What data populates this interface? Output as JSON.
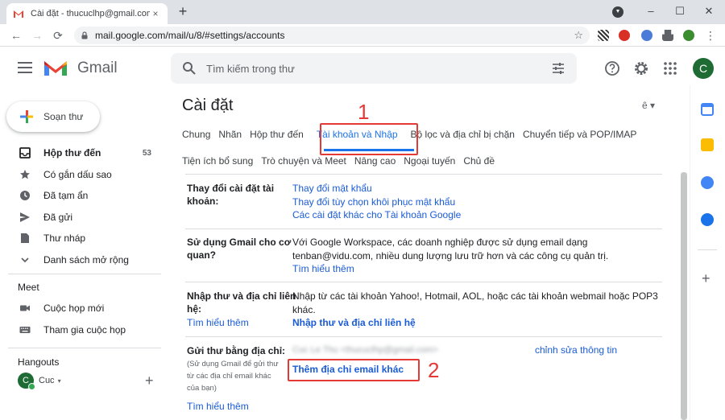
{
  "browser": {
    "tab_title": "Cài đặt - thucuclhp@gmail.com",
    "tab_close": "×",
    "new_tab": "+",
    "url": "mail.google.com/mail/u/8/#settings/accounts",
    "win_minimize": "–",
    "win_restore": "☐",
    "win_close": "✕",
    "back": "←",
    "forward": "→",
    "reload": "⟳",
    "menu": "⋮",
    "bookmark_star": "☆"
  },
  "gmail": {
    "logo_text": "Gmail",
    "search_placeholder": "Tìm kiếm trong thư",
    "avatar_letter": "C"
  },
  "sidebar": {
    "compose_label": "Soạn thư",
    "items": [
      {
        "label": "Hộp thư đến",
        "count": "53",
        "icon": "inbox-icon"
      },
      {
        "label": "Có gắn dấu sao",
        "icon": "star-icon"
      },
      {
        "label": "Đã tạm ẩn",
        "icon": "clock-icon"
      },
      {
        "label": "Đã gửi",
        "icon": "send-icon"
      },
      {
        "label": "Thư nháp",
        "icon": "draft-icon"
      },
      {
        "label": "Danh sách mở rộng",
        "icon": "chevron-down-icon"
      }
    ],
    "meet_title": "Meet",
    "meet_items": [
      {
        "label": "Cuộc họp mới",
        "icon": "video-icon"
      },
      {
        "label": "Tham gia cuộc họp",
        "icon": "keyboard-icon"
      }
    ],
    "hangouts_title": "Hangouts",
    "hangouts_user": "Cuc",
    "hangouts_caret": "▾",
    "hangouts_add": "+"
  },
  "settings": {
    "title": "Cài đặt",
    "lang_picker": "ê ▾",
    "tabs_row1": [
      "Chung",
      "Nhãn",
      "Hộp thư đến",
      "Tài khoản và Nhập",
      "Bộ lọc và địa chỉ bị chặn",
      "Chuyển tiếp và POP/IMAP"
    ],
    "tabs_row2": [
      "Tiện ích bổ sung",
      "Trò chuyện và Meet",
      "Nâng cao",
      "Ngoại tuyến",
      "Chủ đề"
    ],
    "active_tab": "Tài khoản và Nhập",
    "annotation_1": "1",
    "annotation_2": "2",
    "rows": {
      "change_account": {
        "label_line1": "Thay đổi cài đặt tài",
        "label_line2": "khoản:",
        "links": [
          "Thay đổi mật khẩu",
          "Thay đổi tùy chọn khôi phục mật khẩu",
          "Các cài đặt khác cho Tài khoản Google"
        ]
      },
      "workspace": {
        "label_line1": "Sử dụng Gmail cho cơ",
        "label_line2": "quan?",
        "text_line1": "Với Google Workspace, các doanh nghiệp được sử dụng email dạng",
        "text_line2": "tenban@vidu.com, nhiều dung lượng lưu trữ hơn và các công cụ quản trị.",
        "link": "Tìm hiểu thêm"
      },
      "import": {
        "label_line1": "Nhập thư và địa chỉ liên",
        "label_line2": "hệ:",
        "learn_more": "Tìm hiểu thêm",
        "text_line1": "Nhập từ các tài khoản Yahoo!, Hotmail, AOL, hoặc các tài khoản webmail hoặc POP3",
        "text_line2": "khác.",
        "action": "Nhập thư và địa chỉ liên hệ"
      },
      "send_as": {
        "label": "Gửi thư bằng địa chỉ:",
        "sub_line1": "(Sử dụng Gmail để gửi thư",
        "sub_line2": "từ các địa chỉ email khác",
        "sub_line3": "của bạn)",
        "learn_more": "Tìm hiểu thêm",
        "address": "Cuc Le Thu <thucuclhp@gmail.com>",
        "edit": "chỉnh sửa thông tin",
        "add_address": "Thêm địa chỉ email khác"
      }
    }
  }
}
